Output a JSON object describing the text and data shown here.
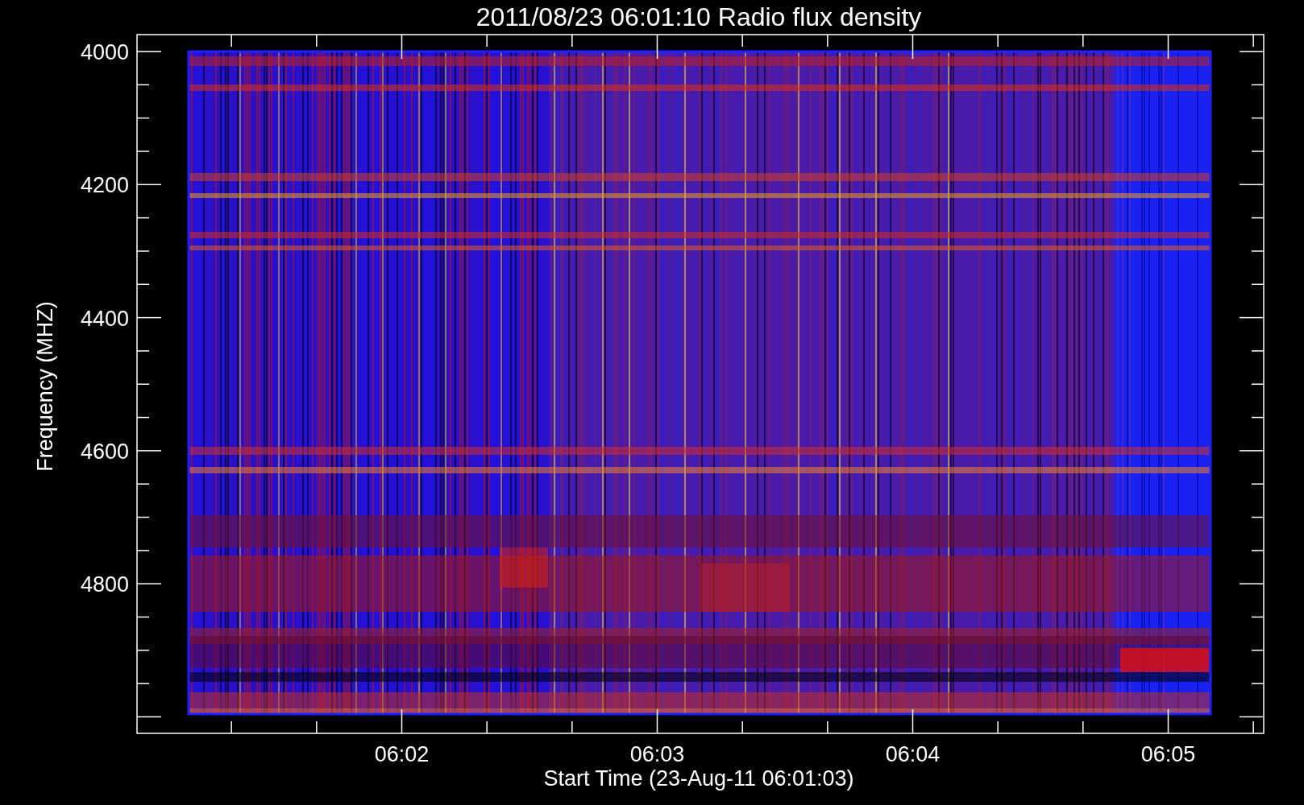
{
  "title": "2011/08/23 06:01:10 Radio flux density",
  "y_axis": {
    "label": "Frequency (MHZ)",
    "ticks": [
      "4000",
      "4200",
      "4400",
      "4600",
      "4800"
    ]
  },
  "x_axis": {
    "label": "Start Time (23-Aug-11 06:01:03)",
    "ticks": [
      "06:02",
      "06:03",
      "06:04",
      "06:05"
    ]
  }
}
